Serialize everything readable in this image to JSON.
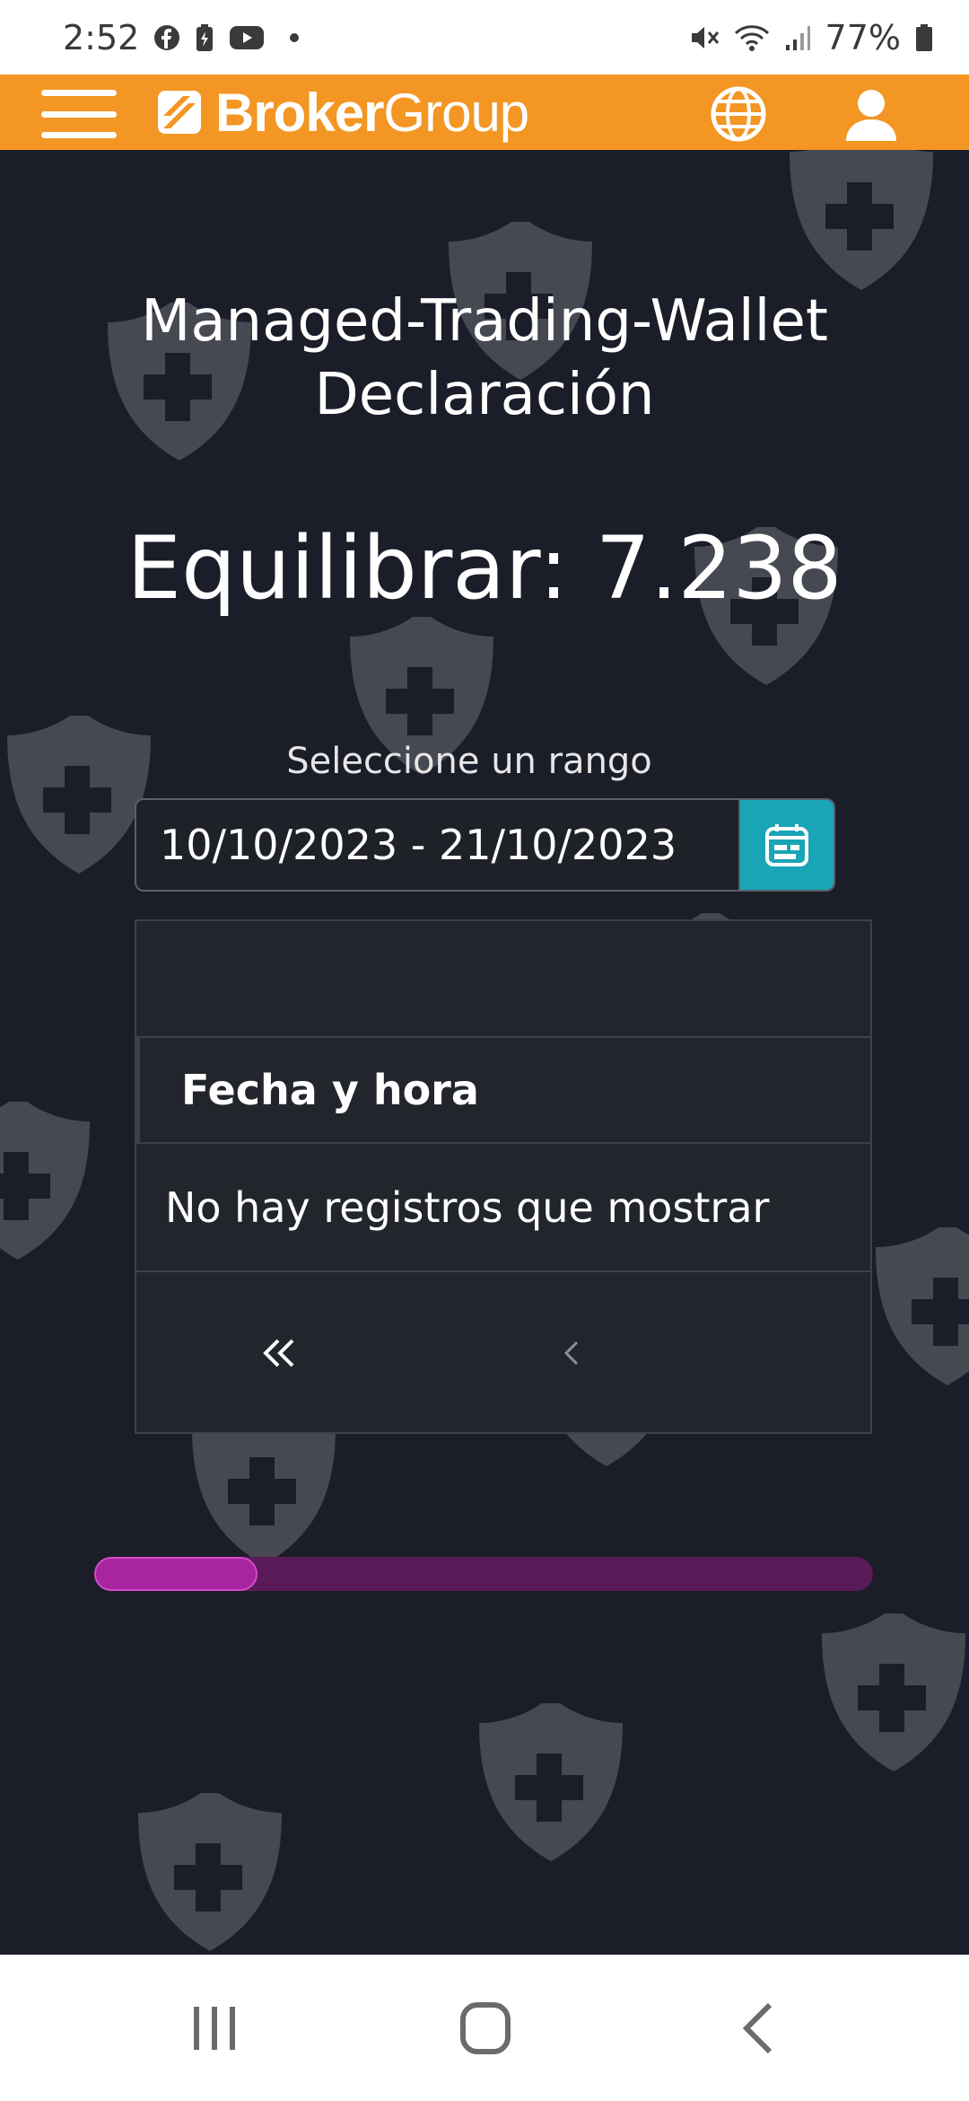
{
  "status_bar": {
    "time": "2:52",
    "battery": "77%",
    "notification_icons": [
      "facebook-icon",
      "battery-saver-icon",
      "youtube-icon",
      "more-dot-icon"
    ],
    "system_icons": [
      "mute-icon",
      "wifi-icon",
      "signal-icon",
      "battery-icon"
    ]
  },
  "header": {
    "brand_strong": "Broker",
    "brand_light": "Group",
    "accent_color": "#f39623"
  },
  "page": {
    "title_line1": "Managed-Trading-Wallet",
    "title_line2": "Declaración",
    "balance_label": "Equilibrar:",
    "balance_value": "7.238",
    "range_label": "Seleccione un rango",
    "date_range": "10/10/2023 - 21/10/2023",
    "background_color": "#1b1d29"
  },
  "table": {
    "column_header": "Fecha y hora",
    "empty_message": "No hay registros que mostrar",
    "pager_first": "«",
    "pager_prev": "‹"
  },
  "scrollbar": {
    "position_fraction": 0.21,
    "thumb_fraction": 0.21,
    "color": "#a8259f"
  }
}
